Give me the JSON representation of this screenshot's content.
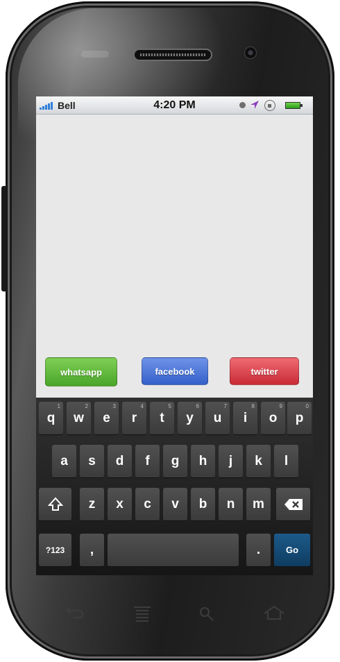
{
  "status_bar": {
    "carrier": "Bell",
    "time": "4:20 PM"
  },
  "share_buttons": {
    "whatsapp": "whatsapp",
    "facebook": "facebook",
    "twitter": "twitter"
  },
  "keyboard": {
    "row1": [
      {
        "label": "q",
        "hint": "1"
      },
      {
        "label": "w",
        "hint": "2"
      },
      {
        "label": "e",
        "hint": "3"
      },
      {
        "label": "r",
        "hint": "4"
      },
      {
        "label": "t",
        "hint": "5"
      },
      {
        "label": "y",
        "hint": "6"
      },
      {
        "label": "u",
        "hint": "7"
      },
      {
        "label": "i",
        "hint": "8"
      },
      {
        "label": "o",
        "hint": "9"
      },
      {
        "label": "p",
        "hint": "0"
      }
    ],
    "row2": [
      "a",
      "s",
      "d",
      "f",
      "g",
      "h",
      "j",
      "k",
      "l"
    ],
    "row3": [
      "z",
      "x",
      "c",
      "v",
      "b",
      "n",
      "m"
    ],
    "symbols_label": "?123",
    "comma_label": ",",
    "period_label": ".",
    "go_label": "Go"
  },
  "colors": {
    "whatsapp": "#49a52a",
    "facebook": "#3460c9",
    "twitter": "#c92b35",
    "go_key": "#0f3d61"
  }
}
